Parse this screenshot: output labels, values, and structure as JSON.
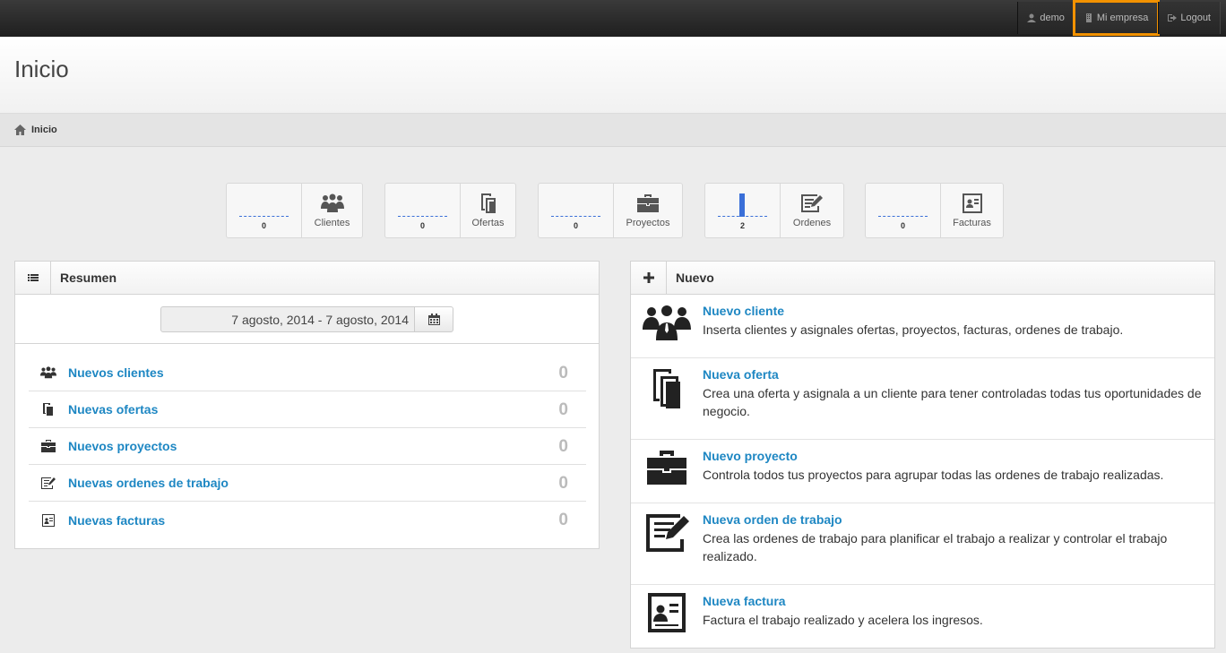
{
  "topbar": {
    "user_label": "demo",
    "company_label": "Mi empresa",
    "logout_label": "Logout"
  },
  "page": {
    "title": "Inicio"
  },
  "breadcrumb": {
    "label": "Inicio"
  },
  "stats": [
    {
      "label": "Clientes",
      "count": "0",
      "icon": "clients-icon"
    },
    {
      "label": "Ofertas",
      "count": "0",
      "icon": "offers-icon"
    },
    {
      "label": "Proyectos",
      "count": "0",
      "icon": "briefcase-icon"
    },
    {
      "label": "Ordenes",
      "count": "2",
      "icon": "work-order-icon"
    },
    {
      "label": "Facturas",
      "count": "0",
      "icon": "invoice-icon"
    }
  ],
  "resumen": {
    "title": "Resumen",
    "date_range": "7 agosto, 2014 - 7 agosto, 2014",
    "items": [
      {
        "label": "Nuevos clientes",
        "count": "0"
      },
      {
        "label": "Nuevas ofertas",
        "count": "0"
      },
      {
        "label": "Nuevos proyectos",
        "count": "0"
      },
      {
        "label": "Nuevas ordenes de trabajo",
        "count": "0"
      },
      {
        "label": "Nuevas facturas",
        "count": "0"
      }
    ]
  },
  "nuevo": {
    "title": "Nuevo",
    "items": [
      {
        "title": "Nuevo cliente",
        "desc": "Inserta clientes y asignales ofertas, proyectos, facturas, ordenes de trabajo."
      },
      {
        "title": "Nueva oferta",
        "desc": "Crea una oferta y asignala a un cliente para tener controladas todas tus oportunidades de negocio."
      },
      {
        "title": "Nuevo proyecto",
        "desc": "Controla todos tus proyectos para agrupar todas las ordenes de trabajo realizadas."
      },
      {
        "title": "Nueva orden de trabajo",
        "desc": "Crea las ordenes de trabajo para planificar el trabajo a realizar y controlar el trabajo realizado."
      },
      {
        "title": "Nueva factura",
        "desc": "Factura el trabajo realizado y acelera los ingresos."
      }
    ]
  },
  "colors": {
    "link": "#1e87c3",
    "highlight": "#f39200",
    "spark": "#3a6fd8"
  }
}
